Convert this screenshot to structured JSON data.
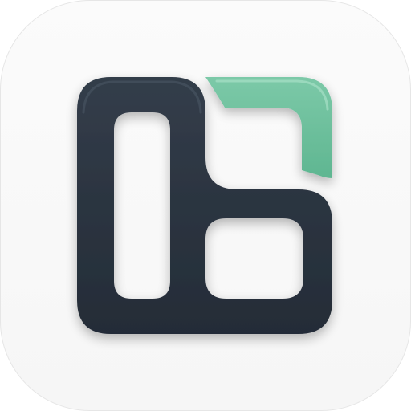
{
  "app_icon": {
    "icon": "layout-panels-logo-icon",
    "colors": {
      "tile_background": "#f7f7f7",
      "tile_border": "#e6e6e6",
      "primary_shape": "#28313d",
      "primary_highlight": "#3c4755",
      "accent_corner": "#6bbf9c",
      "accent_highlight": "#8fd3b6"
    }
  }
}
